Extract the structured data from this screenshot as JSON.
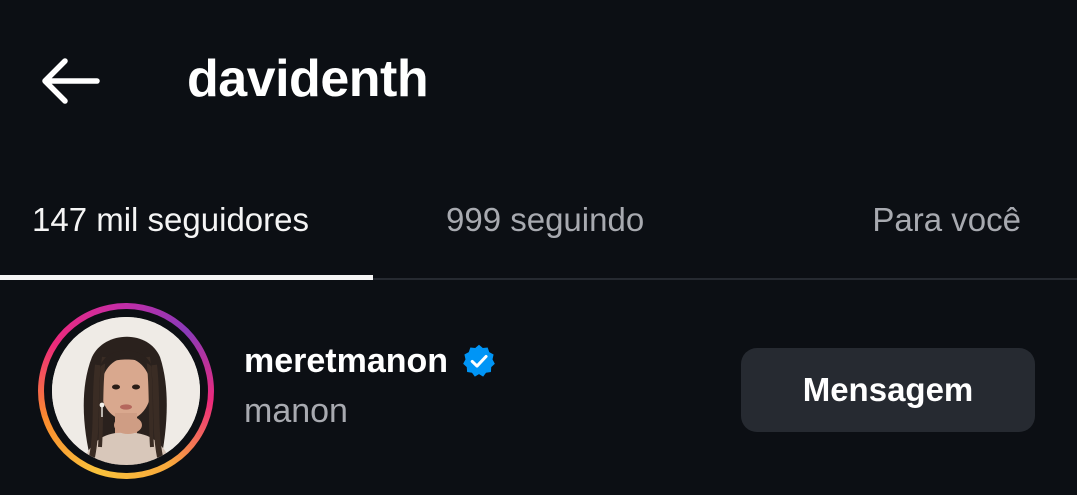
{
  "header": {
    "title": "davidenth",
    "back_icon": "arrow-left-icon"
  },
  "tabs": [
    {
      "label": "147 mil seguidores",
      "active": true
    },
    {
      "label": "999 seguindo",
      "active": false
    },
    {
      "label": "Para você",
      "active": false
    }
  ],
  "list": [
    {
      "username": "meretmanon",
      "verified": true,
      "full_name": "manon",
      "action_label": "Mensagem",
      "has_story_ring": true
    }
  ],
  "colors": {
    "background": "#0c0f14",
    "primary_text": "#f5f5f5",
    "secondary_text": "#a8aab0",
    "button_bg": "#262a31",
    "verified_blue": "#0095f6"
  }
}
